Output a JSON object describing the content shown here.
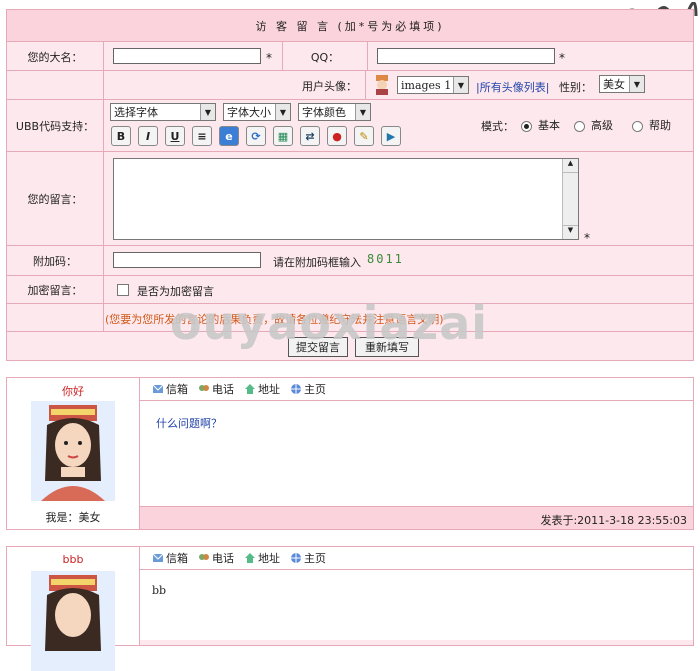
{
  "form": {
    "title": "访 客 留 言 (加*号为必填项)",
    "name_label": "您的大名：",
    "name_value": "",
    "required_mark": "*",
    "qq_label": "QQ：",
    "qq_value": "",
    "avatar_label": "用户头像：",
    "avatar_select": "images 1",
    "avatar_list_link": "|所有头像列表|",
    "gender_label": "性别：",
    "gender_select": "美女",
    "ubb_label": "UBB代码支持：",
    "font_select": "选择字体",
    "size_select": "字体大小",
    "color_select": "字体颜色",
    "toolbar": [
      "B",
      "I",
      "U",
      "≡",
      "e",
      "⟳",
      "▦",
      "⇄",
      "●",
      "✎",
      "▶"
    ],
    "mode_label": "模式：",
    "modes": [
      "基本",
      "高级",
      "帮助"
    ],
    "message_label": "您的留言：",
    "message_value": "",
    "captcha_label": "附加码：",
    "captcha_hint": "请在附加码框输入",
    "captcha_code": "8011",
    "private_label": "加密留言：",
    "private_checkbox": "是否为加密留言",
    "notice": "(您要为您所发的言论的后果负责，故请各位遵纪守法并注意语言文明)",
    "submit": "提交留言",
    "reset": "重新填写"
  },
  "watermark": "ouyaoxiazai",
  "header_items": [
    "信箱",
    "电话",
    "地址",
    "主页"
  ],
  "posts": [
    {
      "nick": "你好",
      "iam": "我是：美女",
      "content": "什么问题啊？",
      "time": "发表于:2011-3-18 23:55:03"
    },
    {
      "nick": "bbb",
      "iam": "",
      "content": "bb",
      "time": ""
    }
  ],
  "colors": {
    "border": "#e6a9b8",
    "panel": "#fde8ee",
    "title": "#fbd3dc",
    "accent": "#2244aa"
  }
}
